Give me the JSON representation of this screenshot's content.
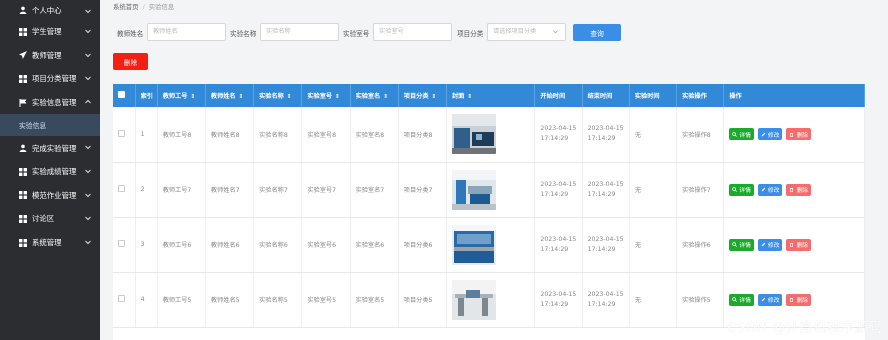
{
  "sidebar": {
    "items": [
      {
        "label": "个人中心",
        "icon": "user-icon"
      },
      {
        "label": "学生管理",
        "icon": "grid-icon"
      },
      {
        "label": "教师管理",
        "icon": "send-icon"
      },
      {
        "label": "项目分类管理",
        "icon": "grid-icon"
      },
      {
        "label": "实验信息管理",
        "icon": "flag-icon"
      },
      {
        "label": "完成实验管理",
        "icon": "user-icon"
      },
      {
        "label": "实验成绩管理",
        "icon": "grid-icon"
      },
      {
        "label": "模范作业管理",
        "icon": "grid-icon"
      },
      {
        "label": "讨论区",
        "icon": "grid-icon"
      },
      {
        "label": "系统管理",
        "icon": "grid-icon"
      }
    ],
    "active_sub": "实验信息"
  },
  "breadcrumb": {
    "home": "系统首页",
    "sep": "/",
    "current": "实验信息"
  },
  "search": {
    "teacher_name": {
      "label": "教师姓名",
      "placeholder": "教师姓名"
    },
    "exp_name": {
      "label": "实验名称",
      "placeholder": "实验名称"
    },
    "exp_room": {
      "label": "实验室号",
      "placeholder": "实验室号"
    },
    "category": {
      "label": "项目分类",
      "placeholder": "请选择项目分类"
    },
    "query_label": "查询"
  },
  "delete_label": "删除",
  "table": {
    "headers": [
      "索引",
      "教师工号",
      "教师姓名",
      "实验名称",
      "实验室号",
      "实验室名",
      "项目分类",
      "封面",
      "开始时间",
      "结束时间",
      "实验时间",
      "实验操作",
      "操作"
    ],
    "sortable": [
      "教师工号",
      "教师姓名",
      "实验名称",
      "实验室号",
      "实验室名",
      "项目分类",
      "封面"
    ],
    "rows": [
      {
        "index": "1",
        "tid": "教师工号8",
        "tname": "教师姓名8",
        "ename": "实验名称8",
        "room": "实验室号8",
        "roomname": "实验室名8",
        "cat": "项目分类8",
        "start_date": "2023-04-15",
        "start_time": "17:14:29",
        "end_date": "2023-04-15",
        "end_time": "17:14:29",
        "etime": "无",
        "eop": "实验操作8"
      },
      {
        "index": "2",
        "tid": "教师工号7",
        "tname": "教师姓名7",
        "ename": "实验名称7",
        "room": "实验室号7",
        "roomname": "实验室名7",
        "cat": "项目分类7",
        "start_date": "2023-04-15",
        "start_time": "17:14:29",
        "end_date": "2023-04-15",
        "end_time": "17:14:29",
        "etime": "无",
        "eop": "实验操作7"
      },
      {
        "index": "3",
        "tid": "教师工号6",
        "tname": "教师姓名6",
        "ename": "实验名称6",
        "room": "实验室号6",
        "roomname": "实验室名6",
        "cat": "项目分类6",
        "start_date": "2023-04-15",
        "start_time": "17:14:29",
        "end_date": "2023-04-15",
        "end_time": "17:14:29",
        "etime": "无",
        "eop": "实验操作6"
      },
      {
        "index": "4",
        "tid": "教师工号5",
        "tname": "教师姓名5",
        "ename": "实验名称5",
        "room": "实验室号5",
        "roomname": "实验室名5",
        "cat": "项目分类5",
        "start_date": "2023-04-15",
        "start_time": "17:14:29",
        "end_date": "2023-04-15",
        "end_time": "17:14:29",
        "etime": "无",
        "eop": "实验操作5"
      }
    ],
    "actions": {
      "detail": "详情",
      "edit": "修改",
      "delete": "删除"
    }
  },
  "watermark": "CSDN @计算机程序源码",
  "colors": {
    "sidebar_bg": "#2b2d31",
    "header_blue": "#3189d8",
    "query_blue": "#3a8ee6",
    "delete_red": "#f21f12",
    "detail_green": "#1bab2c",
    "row_delete": "#f56c6c"
  }
}
